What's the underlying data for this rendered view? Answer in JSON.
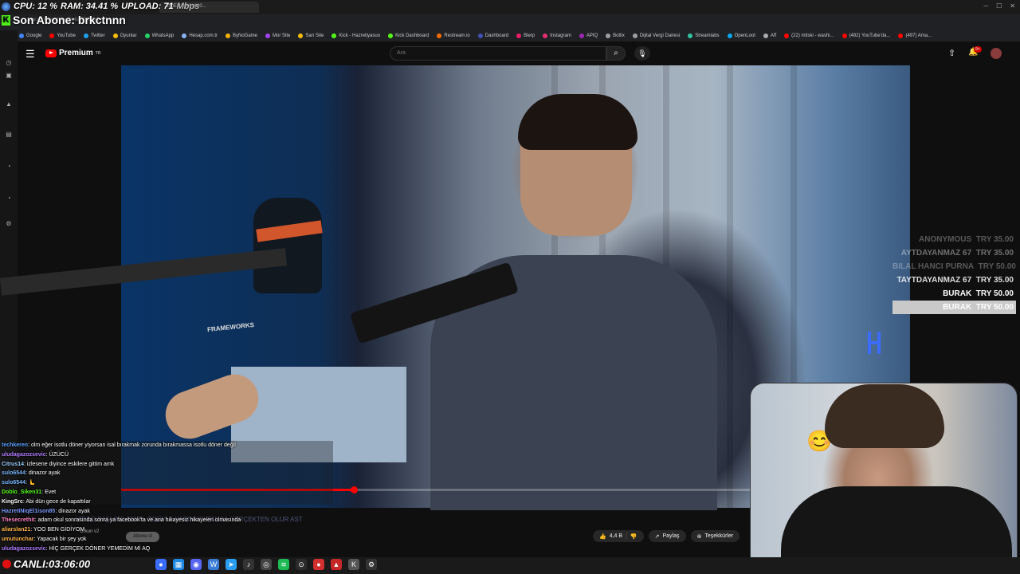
{
  "stats": {
    "cpu": "CPU: 12 %",
    "ram": "RAM:  34.41 %",
    "upload": "UPLOAD: 71",
    "upload_unit": "Mbps"
  },
  "last_sub": "Son Abone: brkctnnn",
  "browser": {
    "tab_title": "VIDEO BAŞI 800...",
    "url": "...ube.com/watch?v=DwtuZZVS4vQ",
    "bookmarks": [
      "Google",
      "YouTube",
      "Twitter",
      "Oyunlar",
      "WhatsApp",
      "Hesap.com.tr",
      "ByNoGame",
      "Mor Site",
      "Sarı Site",
      "Kick - Hazretiyasuo",
      "Kick Dashboard",
      "Restream.io",
      "Dashboard",
      "Blerp",
      "Instagram",
      "APIQ",
      "Botlix",
      "Dijital Vergi Dairesi",
      "Streamlabs",
      "OpenLoot",
      "Aff",
      "(22) mitski - washi...",
      "(482) YouTube'da...",
      "(497) Ama..."
    ]
  },
  "youtube": {
    "logo": "Premium",
    "logo_sup": "TR",
    "search_placeholder": "Ara",
    "bell_badge": "9+",
    "like_count": "4,4 B",
    "share_label": "Paylaş",
    "thanks_label": "Teşekkürler",
    "subscribe_label": "Abone ol",
    "channel_ghost": "Orkun v2",
    "title_ghost": "VİDEO BAŞI 800.000 TL ÖDÜYLA YARDIMCI BULSA GERÇEKTEN OLUR AST",
    "video_prop_text": "FRAMEWORKS"
  },
  "donations": [
    {
      "name": "ANONYMOUS",
      "amount": "TRY 35.00"
    },
    {
      "name": "AYTDAYANMAZ 67",
      "amount": "TRY 35.00"
    },
    {
      "name": "BILAL HANCI PURNA",
      "amount": "TRY 50.00"
    },
    {
      "name": "TAYTDAYANMAZ 67",
      "amount": "TRY 35.00"
    },
    {
      "name": "BURAK",
      "amount": "TRY 50.00"
    },
    {
      "name": "BURAK",
      "amount": "TRY 50.00"
    }
  ],
  "chat": [
    {
      "user": "techkeren",
      "color": "#5aa0ff",
      "text": "olm eğer isotlu döner yiyorsan isal bırakmak zorunda bırakmassa isotlu döner değil"
    },
    {
      "user": "uludagazozsevic",
      "color": "#b07cff",
      "text": "ÜZÜCÜ"
    },
    {
      "user": "Citrus14",
      "color": "#9ad0ff",
      "text": "izlesene diyince eskilere gittim amk"
    },
    {
      "user": "sulo6544",
      "color": "#7ab8ff",
      "text": "dinazor ayak"
    },
    {
      "user": "sulo6544",
      "color": "#7ab8ff",
      "text": "🫷"
    },
    {
      "user": "Doblo_Siken31",
      "color": "#53fc18",
      "text": "Evet"
    },
    {
      "user": "KingSrc",
      "color": "#ffffff",
      "text": "Abi dün gece de kapattılar"
    },
    {
      "user": "HazretiNiqEl1ison85",
      "color": "#7d9bff",
      "text": "dinazor ayak"
    },
    {
      "user": "Thesecrethit",
      "color": "#ff80c0",
      "text": "adam okul sonrasında sonra ya facebook'ta ve ana hikayesiz hikayeleri olmasında"
    },
    {
      "user": "aliarslan21",
      "color": "#ffb347",
      "text": "YOO BEN GİDİYOM"
    },
    {
      "user": "umutunchar",
      "color": "#ffb347",
      "text": "Yapacak bir şey yok"
    },
    {
      "user": "uludagazozsevic",
      "color": "#b07cff",
      "text": "HİÇ GERÇEK DÖNER YEMEDİM Mİ AQ"
    }
  ],
  "live_timer": "CANLI:03:06:00",
  "colors": {
    "youtube_red": "#ff0000",
    "kick_green": "#53fc18",
    "live_red": "#e01010"
  }
}
